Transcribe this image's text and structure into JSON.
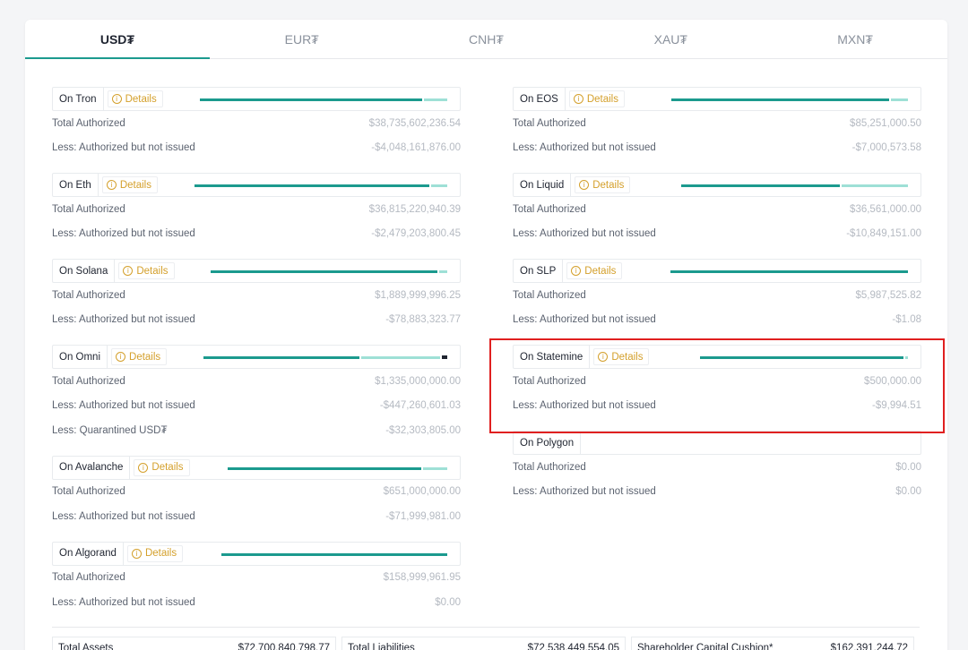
{
  "tabs": [
    "USD₮",
    "EUR₮",
    "CNH₮",
    "XAU₮",
    "MXN₮"
  ],
  "active_tab": "USD₮",
  "details_label": "Details",
  "left_chains": [
    {
      "name": "On Tron",
      "details": true,
      "issued_fraction": 0.9,
      "unissued_fraction": 0.1,
      "rows": [
        {
          "label": "Total Authorized",
          "value": "$38,735,602,236.54"
        },
        {
          "label": "Less: Authorized but not issued",
          "value": "-$4,048,161,876.00"
        }
      ]
    },
    {
      "name": "On Eth",
      "details": true,
      "issued_fraction": 0.93,
      "unissued_fraction": 0.07,
      "rows": [
        {
          "label": "Total Authorized",
          "value": "$36,815,220,940.39"
        },
        {
          "label": "Less: Authorized but not issued",
          "value": "-$2,479,203,800.45"
        }
      ]
    },
    {
      "name": "On Solana",
      "details": true,
      "issued_fraction": 0.96,
      "unissued_fraction": 0.04,
      "rows": [
        {
          "label": "Total Authorized",
          "value": "$1,889,999,996.25"
        },
        {
          "label": "Less: Authorized but not issued",
          "value": "-$78,883,323.77"
        }
      ]
    },
    {
      "name": "On Omni",
      "details": true,
      "issued_fraction": 0.64,
      "unissued_fraction": 0.33,
      "quarantined_fraction": 0.03,
      "rows": [
        {
          "label": "Total Authorized",
          "value": "$1,335,000,000.00"
        },
        {
          "label": "Less: Authorized but not issued",
          "value": "-$447,260,601.03"
        },
        {
          "label": "Less: Quarantined USD₮",
          "value": "-$32,303,805.00"
        }
      ]
    },
    {
      "name": "On Avalanche",
      "details": true,
      "issued_fraction": 0.88,
      "unissued_fraction": 0.12,
      "rows": [
        {
          "label": "Total Authorized",
          "value": "$651,000,000.00"
        },
        {
          "label": "Less: Authorized but not issued",
          "value": "-$71,999,981.00"
        }
      ]
    },
    {
      "name": "On Algorand",
      "details": true,
      "issued_fraction": 1.0,
      "unissued_fraction": 0.0,
      "rows": [
        {
          "label": "Total Authorized",
          "value": "$158,999,961.95"
        },
        {
          "label": "Less: Authorized but not issued",
          "value": "$0.00"
        }
      ]
    }
  ],
  "right_chains": [
    {
      "name": "On EOS",
      "details": true,
      "issued_fraction": 0.92,
      "unissued_fraction": 0.08,
      "rows": [
        {
          "label": "Total Authorized",
          "value": "$85,251,000.50"
        },
        {
          "label": "Less: Authorized but not issued",
          "value": "-$7,000,573.58"
        }
      ]
    },
    {
      "name": "On Liquid",
      "details": true,
      "issued_fraction": 0.7,
      "unissued_fraction": 0.3,
      "rows": [
        {
          "label": "Total Authorized",
          "value": "$36,561,000.00"
        },
        {
          "label": "Less: Authorized but not issued",
          "value": "-$10,849,151.00"
        }
      ]
    },
    {
      "name": "On SLP",
      "details": true,
      "issued_fraction": 1.0,
      "unissued_fraction": 0.0,
      "rows": [
        {
          "label": "Total Authorized",
          "value": "$5,987,525.82"
        },
        {
          "label": "Less: Authorized but not issued",
          "value": "-$1.08"
        }
      ]
    },
    {
      "name": "On Statemine",
      "details": true,
      "issued_fraction": 0.98,
      "unissued_fraction": 0.02,
      "rows": [
        {
          "label": "Total Authorized",
          "value": "$500,000.00"
        },
        {
          "label": "Less: Authorized but not issued",
          "value": "-$9,994.51"
        }
      ]
    },
    {
      "name": "On Polygon",
      "details": false,
      "rows": [
        {
          "label": "Total Authorized",
          "value": "$0.00"
        },
        {
          "label": "Less: Authorized but not issued",
          "value": "$0.00"
        }
      ]
    }
  ],
  "footer": [
    {
      "label": "Total Assets",
      "value": "$72,700,840,798.77"
    },
    {
      "label": "Total Liabilities",
      "value": "$72,538,449,554.05"
    },
    {
      "label": "Shareholder Capital Cushion*",
      "value": "$162,391,244.72"
    }
  ],
  "colors": {
    "issued": "#1b9a8e",
    "unissued": "#9ee0d6",
    "quarantined": "#1f2430",
    "details": "#d4a02c",
    "highlight": "#e02020"
  }
}
